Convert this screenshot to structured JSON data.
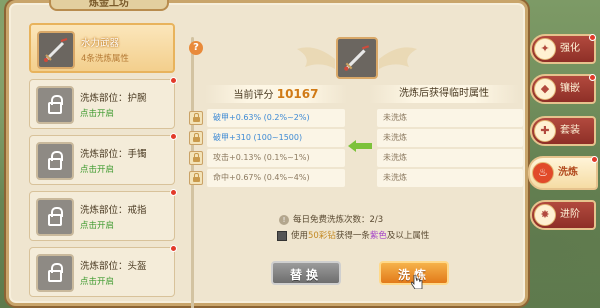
{
  "window": {
    "title": "炼金工坊"
  },
  "slots": [
    {
      "title": "水力武器",
      "sub": "4条洗炼属性",
      "selected": true,
      "locked": false,
      "dot": false
    },
    {
      "title": "洗炼部位：护腕",
      "sub": "点击开启",
      "selected": false,
      "locked": true,
      "dot": true
    },
    {
      "title": "洗炼部位：手镯",
      "sub": "点击开启",
      "selected": false,
      "locked": true,
      "dot": true
    },
    {
      "title": "洗炼部位：戒指",
      "sub": "点击开启",
      "selected": false,
      "locked": true,
      "dot": true
    },
    {
      "title": "洗炼部位：头盔",
      "sub": "点击开启",
      "selected": false,
      "locked": true,
      "dot": true
    }
  ],
  "panel": {
    "help_glyph": "?",
    "current_label": "当前评分",
    "current_score": "10167",
    "temp_label": "洗炼后获得临时属性",
    "rows": [
      {
        "attr": "破甲+0.63% (0.2%~2%)",
        "color": "blue",
        "temp": "未洗炼"
      },
      {
        "attr": "破甲+310 (100~1500)",
        "color": "blue",
        "temp": "未洗炼"
      },
      {
        "attr": "攻击+0.13% (0.1%~1%)",
        "color": "grey",
        "temp": "未洗炼"
      },
      {
        "attr": "命中+0.67% (0.4%~4%)",
        "color": "grey",
        "temp": "未洗炼"
      }
    ],
    "free_prefix": "每日免费洗炼次数：",
    "free_count": "2/3",
    "use_prefix": "使用",
    "use_item": "50彩钻",
    "use_mid": "获得一条",
    "use_color": "紫色",
    "use_suffix": "及以上属性",
    "replace_btn": "替换",
    "refine_btn": "洗炼"
  },
  "side_tabs": [
    {
      "label": "强化",
      "icon": "strengthen-icon",
      "glyph": "✦",
      "active": false,
      "dot": true
    },
    {
      "label": "镶嵌",
      "icon": "inlay-icon",
      "glyph": "◆",
      "active": false,
      "dot": true
    },
    {
      "label": "套装",
      "icon": "suit-icon",
      "glyph": "✚",
      "active": false,
      "dot": false
    },
    {
      "label": "洗炼",
      "icon": "refine-icon",
      "glyph": "♨",
      "active": true,
      "dot": true
    },
    {
      "label": "进阶",
      "icon": "advance-icon",
      "glyph": "✸",
      "active": false,
      "dot": false
    }
  ],
  "colors": {
    "accent": "#e27a1a",
    "score": "#d07a16",
    "blue_attr": "#3e8ad4",
    "green_link": "#3d9a2e",
    "purple": "#a544c8"
  }
}
